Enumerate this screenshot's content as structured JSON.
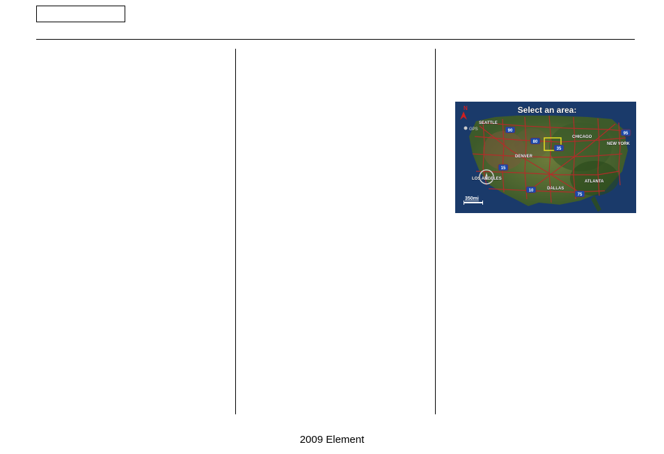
{
  "header": {
    "boxLabel": ""
  },
  "columns": {
    "col1": "",
    "col2": "",
    "col3": ""
  },
  "map": {
    "title": "Select an area:",
    "compass": "N",
    "gpsLabel": "GPS",
    "scale": "350mi",
    "cities": [
      "SEATTLE",
      "DENVER",
      "CHICAGO",
      "NEW YORK",
      "LOS ANGELES",
      "DALLAS",
      "ATLANTA"
    ],
    "highways": [
      "90",
      "80",
      "35",
      "95",
      "15",
      "10",
      "75"
    ]
  },
  "footer": {
    "text": "2009  Element"
  }
}
